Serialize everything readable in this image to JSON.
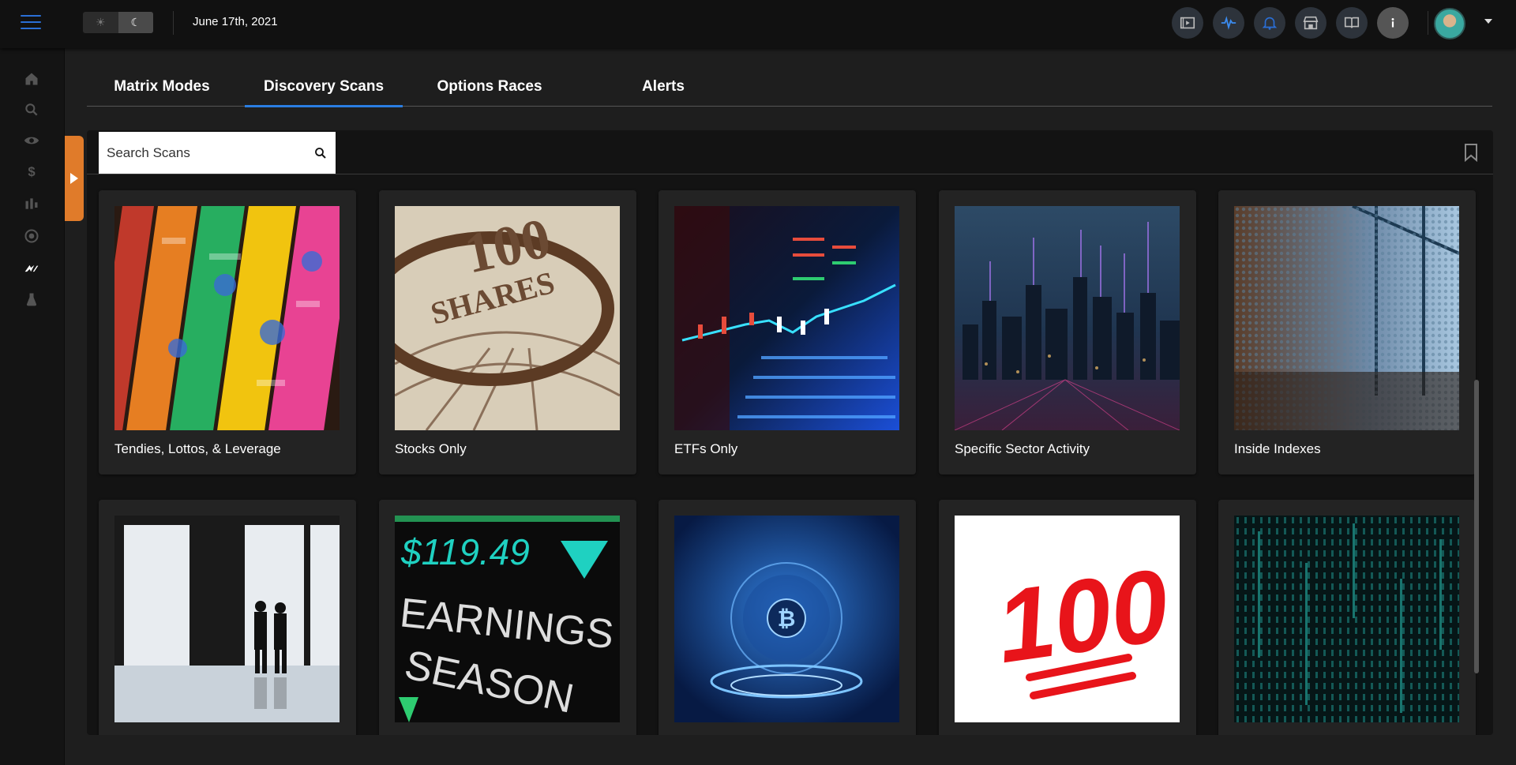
{
  "header": {
    "date": "June 17th, 2021",
    "theme_light_icon": "sun-icon",
    "theme_dark_icon": "moon-icon"
  },
  "top_icons": [
    "video-icon",
    "activity-pulse-icon",
    "bell-icon",
    "store-icon",
    "book-icon",
    "info-icon"
  ],
  "sidebar": [
    "home-icon",
    "search-icon",
    "eye-icon",
    "dollar-icon",
    "candles-icon",
    "target-icon",
    "brand-logo-icon",
    "flask-icon"
  ],
  "tabs": [
    {
      "label": "Matrix Modes",
      "active": false
    },
    {
      "label": "Discovery Scans",
      "active": true
    },
    {
      "label": "Options Races",
      "active": false
    },
    {
      "label": "Alerts",
      "active": false
    }
  ],
  "search": {
    "placeholder": "Search Scans",
    "value": ""
  },
  "cards": [
    {
      "title": "Tendies, Lottos, & Leverage",
      "image": "lottery-tickets"
    },
    {
      "title": "Stocks Only",
      "image": "share-certificate-100"
    },
    {
      "title": "ETFs Only",
      "image": "stock-ticker-screen"
    },
    {
      "title": "Specific Sector Activity",
      "image": "city-skyline-data"
    },
    {
      "title": "Inside Indexes",
      "image": "office-lobby-dots"
    },
    {
      "title": "",
      "image": "silhouettes-window"
    },
    {
      "title": "",
      "image": "earnings-season-board"
    },
    {
      "title": "",
      "image": "bitcoin-hologram"
    },
    {
      "title": "",
      "image": "hundred-emoji"
    },
    {
      "title": "",
      "image": "matrix-code"
    }
  ],
  "ticker_board": {
    "price": "$119.49",
    "line1": "EARNINGS",
    "line2": "SEASON"
  },
  "hundred_text": "100",
  "shares_text": "SHARES",
  "colors": {
    "accent_blue": "#2a7de1",
    "drawer_orange": "#e07b2a",
    "background": "#1e1e1e",
    "card": "#232323"
  }
}
